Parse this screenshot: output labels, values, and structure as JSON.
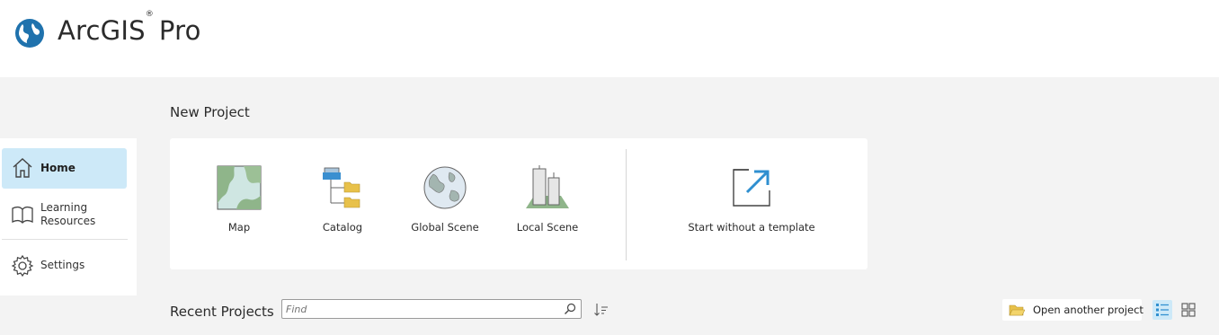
{
  "app": {
    "name": "ArcGIS",
    "registered": "®",
    "product": "Pro"
  },
  "sidebar": {
    "items": [
      {
        "label": "Home",
        "icon": "home-icon",
        "active": true
      },
      {
        "label": "Learning\nResources",
        "icon": "book-icon",
        "active": false
      },
      {
        "label": "Settings",
        "icon": "gear-icon",
        "active": false
      }
    ]
  },
  "new_project": {
    "title": "New Project",
    "templates": [
      {
        "label": "Map",
        "icon": "map-template-icon"
      },
      {
        "label": "Catalog",
        "icon": "catalog-template-icon"
      },
      {
        "label": "Global Scene",
        "icon": "globe-template-icon"
      },
      {
        "label": "Local Scene",
        "icon": "local-scene-template-icon"
      }
    ],
    "blank": {
      "label": "Start without a template",
      "icon": "external-arrow-icon"
    }
  },
  "recent": {
    "title": "Recent Projects",
    "search_placeholder": "Find",
    "search_value": "",
    "open_label": "Open another project"
  },
  "colors": {
    "accent": "#2f8fd0",
    "active_bg": "#cde9f8",
    "folder": "#e8c14a",
    "logo": "#1f72ad"
  }
}
